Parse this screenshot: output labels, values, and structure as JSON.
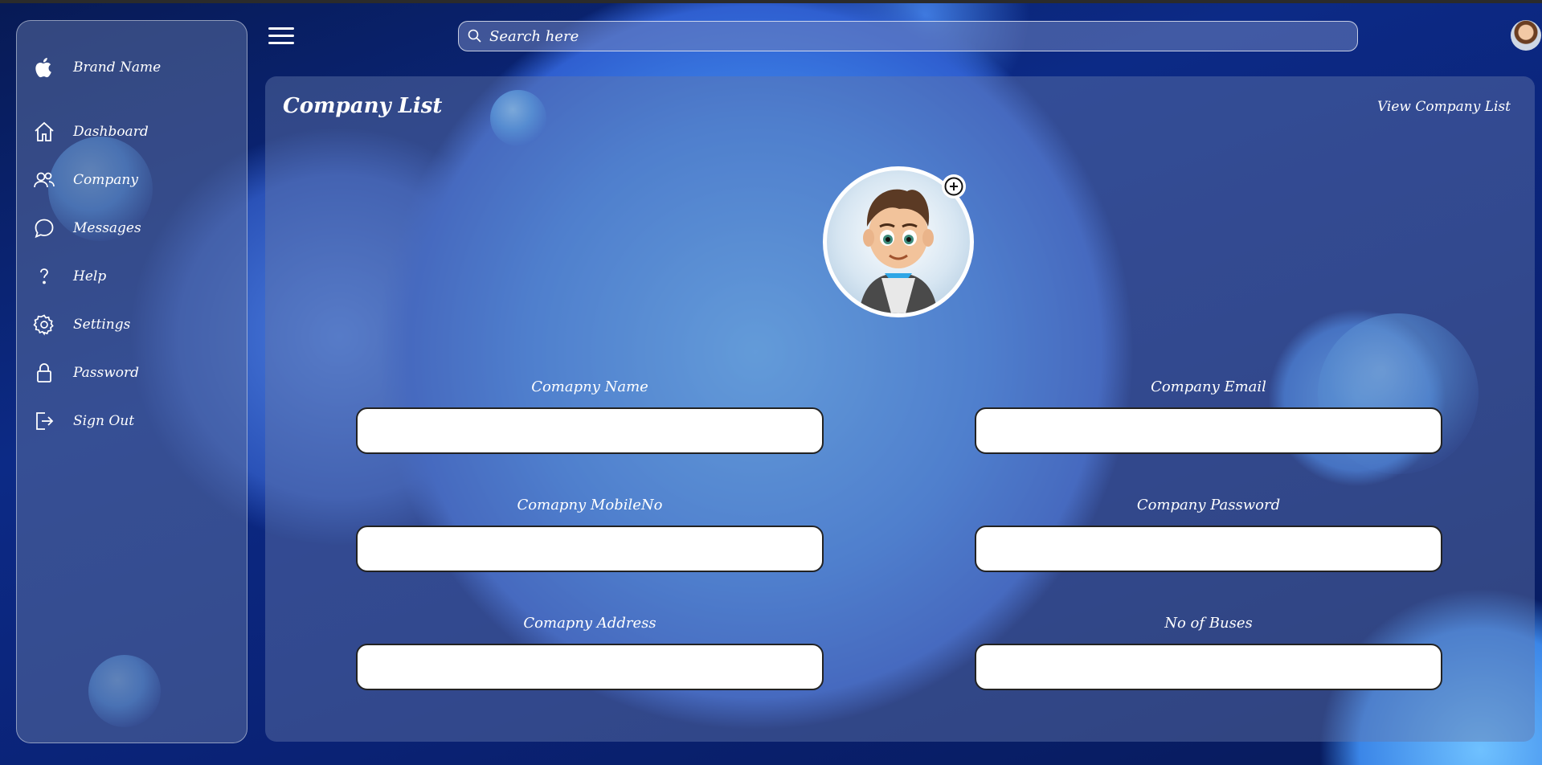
{
  "sidebar": {
    "brand": {
      "label": "Brand Name",
      "icon": "apple-icon"
    },
    "items": [
      {
        "label": "Dashboard",
        "icon": "home-icon"
      },
      {
        "label": "Company",
        "icon": "users-icon"
      },
      {
        "label": "Messages",
        "icon": "chat-icon"
      },
      {
        "label": "Help",
        "icon": "question-icon"
      },
      {
        "label": "Settings",
        "icon": "gear-icon"
      },
      {
        "label": "Password",
        "icon": "lock-icon"
      },
      {
        "label": "Sign Out",
        "icon": "sign-out-icon"
      }
    ]
  },
  "header": {
    "search": {
      "placeholder": "Search here",
      "value": ""
    }
  },
  "main": {
    "title": "Company List",
    "view_link": "View Company List",
    "form": {
      "fields": [
        {
          "label": "Comapny Name",
          "value": ""
        },
        {
          "label": "Company Email",
          "value": ""
        },
        {
          "label": "Comapny MobileNo",
          "value": ""
        },
        {
          "label": "Company Password",
          "value": ""
        },
        {
          "label": "Comapny Address",
          "value": ""
        },
        {
          "label": "No of Buses",
          "value": ""
        }
      ]
    }
  },
  "colors": {
    "background": "#0c2a86",
    "panel": "#6478aa",
    "input_bg": "#ffffff",
    "text": "#ffffff"
  }
}
